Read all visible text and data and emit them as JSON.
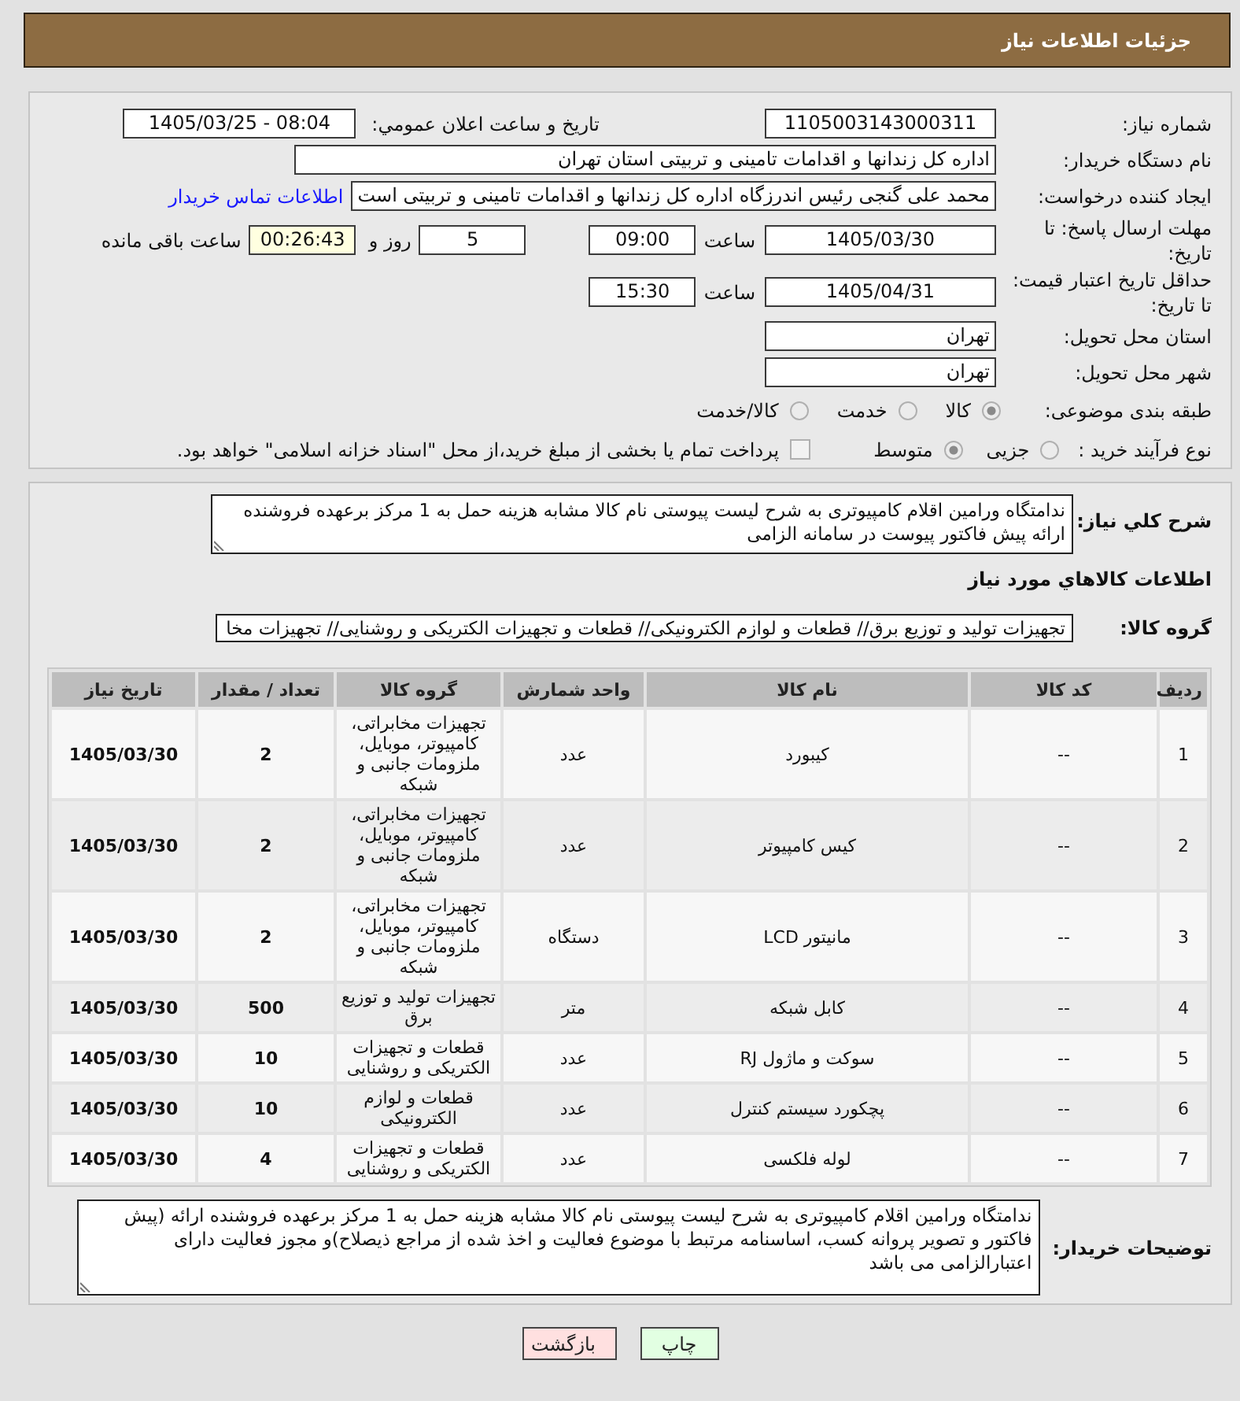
{
  "header": {
    "title": "جزئیات اطلاعات نیاز"
  },
  "details": {
    "need_number": {
      "label": "شماره نیاز:",
      "value": "1105003143000311"
    },
    "announce": {
      "label": "تاريخ و ساعت اعلان عمومي:",
      "value": "1405/03/25 - 08:04"
    },
    "buyer_org": {
      "label": "نام دستگاه خریدار:",
      "value": "اداره کل زندانها و اقدامات تامینی و تربیتی استان تهران"
    },
    "requester": {
      "label": "ایجاد کننده درخواست:",
      "value": "محمد علی گنجی رئیس اندرزگاه اداره کل زندانها و اقدامات تامینی و تربیتی است",
      "link": "اطلاعات تماس خریدار"
    },
    "deadline": {
      "label": "مهلت ارسال پاسخ: تا تاریخ:",
      "date": "1405/03/30",
      "time_label": "ساعت",
      "time": "09:00",
      "days": "5",
      "days_label": "روز و",
      "remaining": "00:26:43",
      "remaining_label": "ساعت باقی مانده"
    },
    "validity": {
      "label": "حداقل تاریخ اعتبار قیمت: تا تاریخ:",
      "date": "1405/04/31",
      "time_label": "ساعت",
      "time": "15:30"
    },
    "province": {
      "label": "استان محل تحویل:",
      "value": "تهران"
    },
    "city": {
      "label": "شهر محل تحویل:",
      "value": "تهران"
    },
    "category": {
      "label": "طبقه بندی موضوعی:",
      "options": [
        {
          "label": "کالا",
          "selected": true
        },
        {
          "label": "خدمت",
          "selected": false
        },
        {
          "label": "کالا/خدمت",
          "selected": false
        }
      ]
    },
    "process": {
      "label": "نوع فرآیند خرید :",
      "options": [
        {
          "label": "جزیی",
          "selected": false
        },
        {
          "label": "متوسط",
          "selected": true
        }
      ],
      "treasury": {
        "label": "پرداخت تمام یا بخشی از مبلغ خرید،از محل \"اسناد خزانه اسلامی\" خواهد بود.",
        "checked": false
      }
    }
  },
  "need": {
    "description_label": "شرح کلي نياز:",
    "description": "ندامتگاه ورامین اقلام کامپیوتری به شرح لیست پیوستی نام کالا مشابه هزینه حمل به 1 مرکز برعهده فروشنده ارائه پیش فاکتور پیوست در سامانه الزامی",
    "goods_title": "اطلاعات کالاهاي مورد نياز",
    "group_label": "گروه کالا:",
    "group": "تجهیزات تولید و توزیع برق// قطعات و لوازم الکترونیکی// قطعات و تجهیزات الکتریکی و روشنایی// تجهیزات مخا",
    "table": {
      "columns": [
        "ردیف",
        "کد کالا",
        "نام کالا",
        "واحد شمارش",
        "گروه کالا",
        "تعداد / مقدار",
        "تاریخ نیاز"
      ],
      "rows": [
        [
          "1",
          "--",
          "کیبورد",
          "عدد",
          "تجهیزات مخابراتی، کامپیوتر، موبایل، ملزومات جانبی و شبکه",
          "2",
          "1405/03/30"
        ],
        [
          "2",
          "--",
          "کیس کامپیوتر",
          "عدد",
          "تجهیزات مخابراتی، کامپیوتر، موبایل، ملزومات جانبی و شبکه",
          "2",
          "1405/03/30"
        ],
        [
          "3",
          "--",
          "مانیتور LCD",
          "دستگاه",
          "تجهیزات مخابراتی، کامپیوتر، موبایل، ملزومات جانبی و شبکه",
          "2",
          "1405/03/30"
        ],
        [
          "4",
          "--",
          "کابل شبکه",
          "متر",
          "تجهیزات تولید و توزیع برق",
          "500",
          "1405/03/30"
        ],
        [
          "5",
          "--",
          "سوکت و ماژول RJ",
          "عدد",
          "قطعات و تجهیزات الکتریکی و روشنایی",
          "10",
          "1405/03/30"
        ],
        [
          "6",
          "--",
          "پچکورد سیستم کنترل",
          "عدد",
          "قطعات و لوازم الکترونیکی",
          "10",
          "1405/03/30"
        ],
        [
          "7",
          "--",
          "لوله فلکسی",
          "عدد",
          "قطعات و تجهیزات الکتریکی و روشنایی",
          "4",
          "1405/03/30"
        ]
      ]
    },
    "notes_label": "توضیحات خریدار:",
    "notes": "ندامتگاه ورامین اقلام کامپیوتری به شرح لیست پیوستی نام کالا مشابه هزینه حمل به 1 مرکز برعهده فروشنده ارائه (پیش فاکتور و تصویر پروانه کسب، اساسنامه مرتبط با موضوع فعالیت و اخذ شده از مراجع ذیصلاح)و مجوز فعالیت دارای اعتبارالزامی می باشد"
  },
  "buttons": [
    {
      "label": "چاپ",
      "kind": "print"
    },
    {
      "label": "بازگشت",
      "kind": "back"
    }
  ]
}
